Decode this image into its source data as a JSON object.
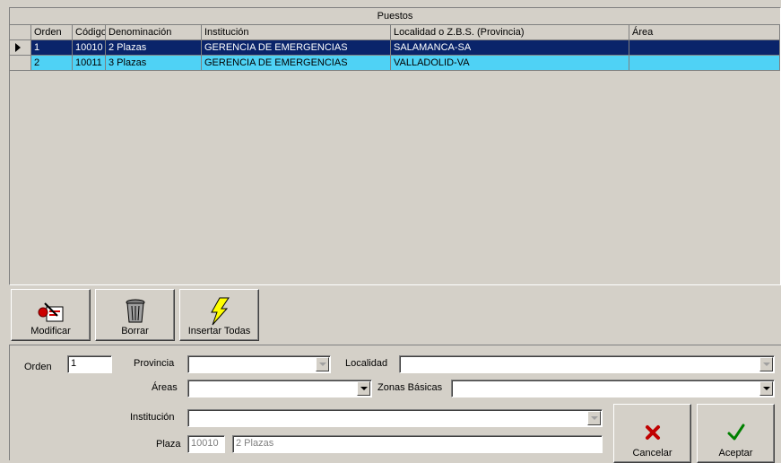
{
  "grid": {
    "title": "Puestos",
    "columns": [
      "Orden",
      "Código",
      "Denominación",
      "Institución",
      "Localidad o Z.B.S. (Provincia)",
      "Área"
    ],
    "rows": [
      {
        "orden": "1",
        "codigo": "10010",
        "denominacion": "2 Plazas",
        "institucion": "GERENCIA DE EMERGENCIAS",
        "localidad": "SALAMANCA-SA",
        "area": ""
      },
      {
        "orden": "2",
        "codigo": "10011",
        "denominacion": "3 Plazas",
        "institucion": "GERENCIA DE EMERGENCIAS",
        "localidad": "VALLADOLID-VA",
        "area": ""
      }
    ]
  },
  "toolbar": {
    "modificar": "Modificar",
    "borrar": "Borrar",
    "insertar": "Insertar Todas"
  },
  "form": {
    "orden_label": "Orden",
    "orden_value": "1",
    "provincia_label": "Provincia",
    "provincia_value": "",
    "localidad_label": "Localidad",
    "localidad_value": "",
    "areas_label": "Áreas",
    "areas_value": "",
    "zonas_label": "Zonas Básicas",
    "zonas_value": "",
    "institucion_label": "Institución",
    "institucion_value": "",
    "plaza_label": "Plaza",
    "plaza_code": "10010",
    "plaza_name": "2 Plazas"
  },
  "actions": {
    "cancelar": "Cancelar",
    "aceptar": "Aceptar"
  },
  "colors": {
    "selected_row": "#0a246a",
    "alt_row": "#4fd2f5",
    "cancel_icon": "#c00000",
    "accept_icon": "#008000"
  }
}
